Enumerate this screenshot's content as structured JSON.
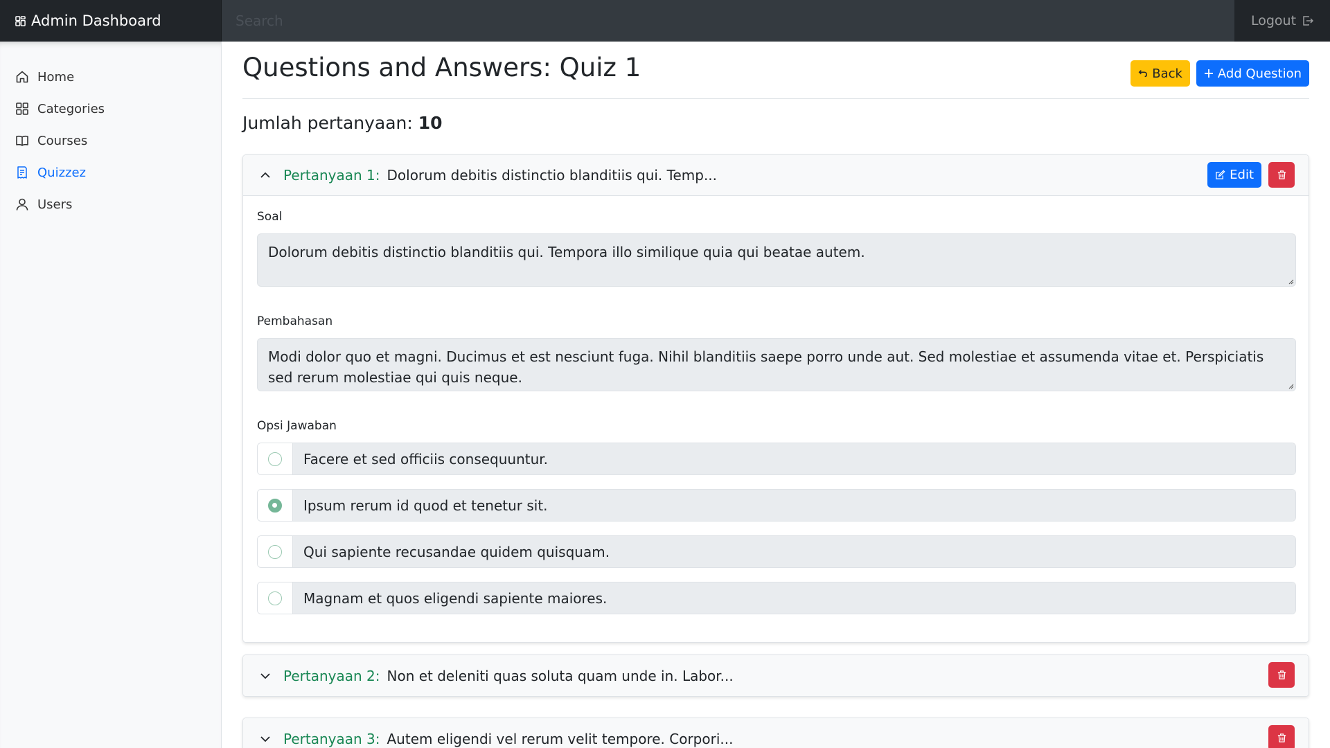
{
  "navbar": {
    "brand": "Admin Dashboard",
    "search_placeholder": "Search",
    "logout_label": "Logout"
  },
  "sidebar": {
    "items": [
      {
        "label": "Home",
        "icon": "home-icon"
      },
      {
        "label": "Categories",
        "icon": "grid-icon"
      },
      {
        "label": "Courses",
        "icon": "book-icon"
      },
      {
        "label": "Quizzez",
        "icon": "quiz-icon",
        "active": true
      },
      {
        "label": "Users",
        "icon": "user-icon"
      }
    ]
  },
  "main": {
    "title": "Questions and Answers: Quiz 1",
    "back_label": "Back",
    "add_label": "Add Question",
    "count_label": "Jumlah pertanyaan:",
    "count_value": "10",
    "edit_label": "Edit"
  },
  "questions": [
    {
      "label": "Pertanyaan 1:",
      "preview": "Dolorum debitis distinctio blanditiis qui. Temp...",
      "expanded": true,
      "soal_label": "Soal",
      "soal": "Dolorum debitis distinctio blanditiis qui. Tempora illo similique quia qui beatae autem.",
      "pembahasan_label": "Pembahasan",
      "pembahasan": "Modi dolor quo et magni. Ducimus et est nesciunt fuga. Nihil blanditiis saepe porro unde aut. Sed molestiae et assumenda vitae et. Perspiciatis sed rerum molestiae qui quis neque.",
      "options_label": "Opsi Jawaban",
      "options": [
        {
          "text": "Facere et sed officiis consequuntur.",
          "correct": false
        },
        {
          "text": "Ipsum rerum id quod et tenetur sit.",
          "correct": true
        },
        {
          "text": "Qui sapiente recusandae quidem quisquam.",
          "correct": false
        },
        {
          "text": "Magnam et quos eligendi sapiente maiores.",
          "correct": false
        }
      ]
    },
    {
      "label": "Pertanyaan 2:",
      "preview": "Non et deleniti quas soluta quam unde in. Labor...",
      "expanded": false
    },
    {
      "label": "Pertanyaan 3:",
      "preview": "Autem eligendi vel rerum velit tempore. Corpori...",
      "expanded": false
    }
  ],
  "colors": {
    "navbar": "#343a40",
    "brand_bg": "#212529",
    "primary": "#0d6efd",
    "warning": "#ffc107",
    "danger": "#dc3545",
    "success_text": "#198754"
  }
}
